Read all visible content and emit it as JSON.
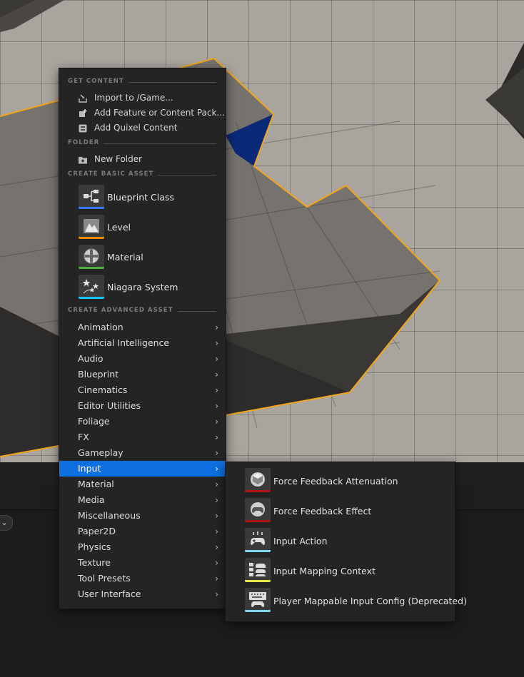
{
  "menu": {
    "sections": {
      "get_content": "GET CONTENT",
      "folder": "FOLDER",
      "basic": "CREATE BASIC ASSET",
      "advanced": "CREATE ADVANCED ASSET"
    },
    "get_content_items": [
      {
        "label": "Import to /Game...",
        "icon": "import-icon"
      },
      {
        "label": "Add Feature or Content Pack...",
        "icon": "add-feature-icon"
      },
      {
        "label": "Add Quixel Content",
        "icon": "quixel-icon"
      }
    ],
    "folder_items": [
      {
        "label": "New Folder",
        "icon": "new-folder-icon"
      }
    ],
    "basic_assets": [
      {
        "label": "Blueprint Class",
        "icon": "blueprint-class-icon",
        "color": "#3b78ff"
      },
      {
        "label": "Level",
        "icon": "level-icon",
        "color": "#f08c00"
      },
      {
        "label": "Material",
        "icon": "material-icon",
        "color": "#4caf3a"
      },
      {
        "label": "Niagara System",
        "icon": "niagara-icon",
        "color": "#19c3ff"
      }
    ],
    "advanced_assets": [
      {
        "label": "Animation"
      },
      {
        "label": "Artificial Intelligence"
      },
      {
        "label": "Audio"
      },
      {
        "label": "Blueprint"
      },
      {
        "label": "Cinematics"
      },
      {
        "label": "Editor Utilities"
      },
      {
        "label": "Foliage"
      },
      {
        "label": "FX"
      },
      {
        "label": "Gameplay"
      },
      {
        "label": "Input",
        "active": true
      },
      {
        "label": "Material"
      },
      {
        "label": "Media"
      },
      {
        "label": "Miscellaneous"
      },
      {
        "label": "Paper2D"
      },
      {
        "label": "Physics"
      },
      {
        "label": "Texture"
      },
      {
        "label": "Tool Presets"
      },
      {
        "label": "User Interface"
      }
    ],
    "submenu_arrow": "›"
  },
  "submenu": {
    "items": [
      {
        "label": "Force Feedback Attenuation",
        "icon": "force-feedback-attenuation-icon",
        "color": "#b01515"
      },
      {
        "label": "Force Feedback Effect",
        "icon": "force-feedback-effect-icon",
        "color": "#b01515"
      },
      {
        "label": "Input Action",
        "icon": "input-action-icon",
        "color": "#7fd6f0"
      },
      {
        "label": "Input Mapping Context",
        "icon": "input-mapping-context-icon",
        "color": "#e8e84a"
      },
      {
        "label": "Player Mappable Input Config (Deprecated)",
        "icon": "player-mappable-input-config-icon",
        "color": "#7fd6f0"
      }
    ]
  },
  "colors": {
    "active_highlight": "#0e70e0",
    "selection_outline": "#f2a51a",
    "menu_bg": "#242424"
  }
}
